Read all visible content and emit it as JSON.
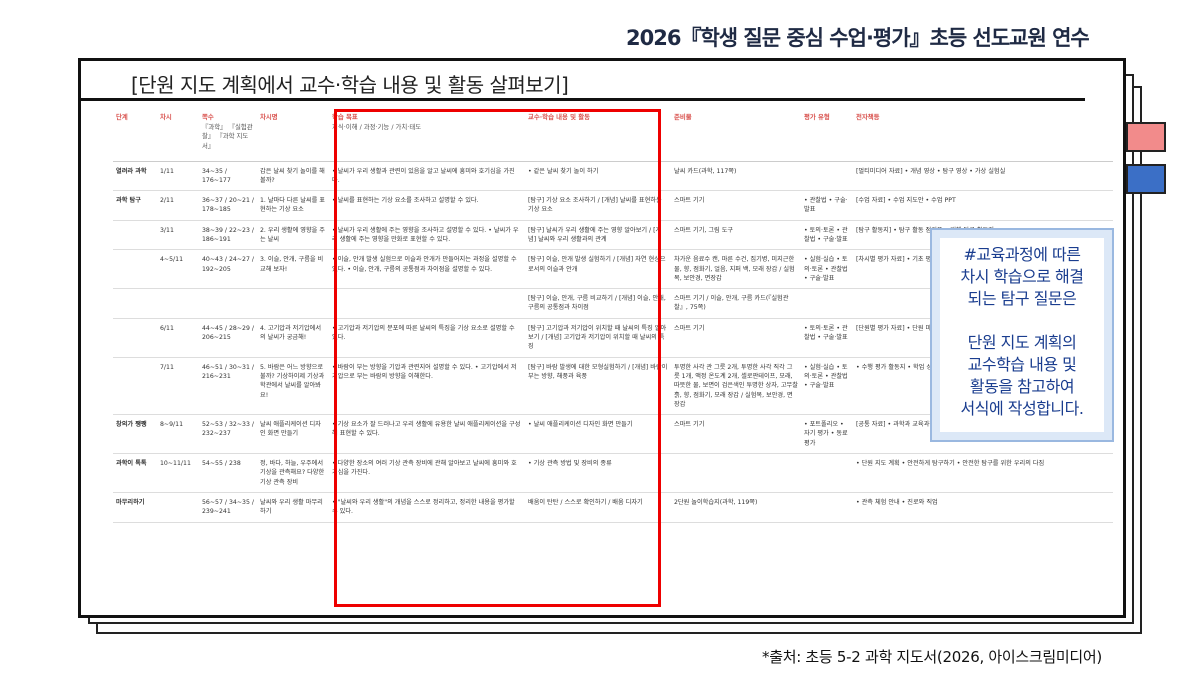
{
  "header": {
    "title": "2026『학생 질문 중심 수업·평가』초등 선도교원 연수"
  },
  "section": {
    "title": "[단원 지도 계획에서 교수·학습 내용 및 활동 살펴보기]"
  },
  "table": {
    "headers": [
      "단계",
      "차시",
      "쪽수",
      "차시명",
      "학습 목표",
      "교수·학습 내용 및 활동",
      "준비물",
      "평가 유형",
      "전자책등"
    ],
    "header_notes": {
      "pages": "『과학』 『실험관찰』 『과학 지도서』",
      "goal": "지식·이해 / 과정·기능 / 가치·태도"
    },
    "rows": [
      {
        "stage": "열려라 과학",
        "period": "1/11",
        "pages": "34~35 / 176~177",
        "name": "갑은 날씨 찾기 놀이를 해 볼까?",
        "goal": "• 날씨가 우리 생활과 관련이 있음을 알고 날씨에 흥미와 호기심을 가진다.",
        "activity": "• 같은 날씨 찾기 놀이 하기",
        "materials": "날씨 카드(과학, 117쪽)",
        "eval": "",
        "ebook": "[멀티미디어 자료] • 개념 영상 • 탐구 영상 • 가상 실험실"
      },
      {
        "stage": "과학 탐구",
        "period": "2/11",
        "pages": "36~37 / 20~21 / 178~185",
        "name": "1. 날마다 다른 날씨를 표현하는 기상 요소",
        "goal": "• 날씨를 표현하는 기상 요소를 조사하고 설명할 수 있다.",
        "activity": "[탐구] 기상 요소 조사하기 / [개념] 날씨를 표현하는 기상 요소",
        "materials": "스마트 기기",
        "eval": "• 관찰법 • 구술·발표",
        "ebook": "[수업 자료] • 수업 지도안 • 수업 PPT"
      },
      {
        "stage": "",
        "period": "3/11",
        "pages": "38~39 / 22~23 / 186~191",
        "name": "2. 우리 생활에 영향을 주는 날씨",
        "goal": "• 날씨가 우리 생활에 주는 영향을 조사하고 설명할 수 있다. • 날씨가 우리 생활에 주는 영향을 만화로 표현할 수 있다.",
        "activity": "[탐구] 날씨가 우리 생활에 주는 영향 알아보기 / [개념] 날씨와 우리 생활과의 관계",
        "materials": "스마트 기기, 그림 도구",
        "eval": "• 토의·토론 • 관찰법 • 구술·발표",
        "ebook": "[탐구 활동지] • 탐구 활동 점검표 • 대체 탐구 활동지"
      },
      {
        "stage": "",
        "period": "4~5/11",
        "pages": "40~43 / 24~27 / 192~205",
        "name": "3. 이슬, 안개, 구름을 비교해 보자!",
        "goal": "• 이슬, 안개 발생 실험으로 이슬과 안개가 만들어지는 과정을 설명할 수 있다. • 이슬, 안개, 구름의 공통점과 차이점을 설명할 수 있다.",
        "activity": "[탐구] 이슬, 안개 발생 실험하기 / [개념] 자연 현상으로서의 이슬과 안개",
        "materials": "차가운 음료수 캔, 마른 수건, 집기병, 미지근한 물, 향, 점화기, 얼음, 지퍼 백, 모래 장갑 / 실험복, 보안경, 면장갑",
        "eval": "• 실험·실습 • 토의·토론 • 관찰법 • 구술·발표",
        "ebook": "[차시별 평가 자료] • 기초 평가 • 실력 평가 • 심화 학습 평가 • 차시 평가 방법 및 채점 기준"
      },
      {
        "stage": "",
        "period": "",
        "pages": "",
        "name": "",
        "goal": "",
        "activity": "[탐구] 이슬, 안개, 구름 비교하기 / [개념] 이슬, 안개, 구름의 공통점과 차이점",
        "materials": "스마트 기기 / 이슬, 안개, 구름 카드(『실험관찰』, 75쪽)",
        "eval": "",
        "ebook": ""
      },
      {
        "stage": "",
        "period": "6/11",
        "pages": "44~45 / 28~29 / 206~215",
        "name": "4. 고기압과 저기압에서의 날씨가 궁금해!",
        "goal": "• 고기압과 저기압의 분포에 따른 날씨의 특징을 기상 요소로 설명할 수 있다.",
        "activity": "[탐구] 고기압과 저기압이 위치할 때 날씨의 특징 알아보기 / [개념] 고기압과 저기압이 위치할 때 날씨의 특징",
        "materials": "스마트 기기",
        "eval": "• 토의·토론 • 관찰법 • 구술·발표",
        "ebook": "[단원별 평가 자료] • 단원 마무리 활동지 • 놀이로 마무리 활동지"
      },
      {
        "stage": "",
        "period": "7/11",
        "pages": "46~51 / 30~31 / 216~231",
        "name": "5. 바람은 어느 방향으로 불까? 기상하이제 기상과학관에서 날씨를 알아봐요!",
        "goal": "• 바람이 부는 방향을 기압과 관련지어 설명할 수 있다. • 고기압에서 저기압으로 부는 바람의 방향을 이해한다.",
        "activity": "[탐구] 바람 발생에 대한 모형실험하기 / [개념] 바람이 부는 방향, 해풍과 육풍",
        "materials": "투명한 사각 관 그릇 2개, 투명한 사각 직각 그릇 1개, 액정 온도계 2개, 셀로판테이프, 모래, 따뜻한 물, 보면이 검은색인 투명한 상자, 고무찰흙, 향, 점화기, 모래 장갑 / 실험복, 보안경, 면장갑",
        "eval": "• 실험·실습 • 토의·토론 • 관찰법 • 구술·발표",
        "ebook": "• 수행 평가 활동지 • 학업 성취도 평가 • 심화 평가 • 서술형 평가 • 단원 평가"
      },
      {
        "stage": "창의가 쨍쨍",
        "period": "8~9/11",
        "pages": "52~53 / 32~33 / 232~237",
        "name": "날씨 애플리케이션 디자인 화면 만들기",
        "goal": "• 기상 요소가 잘 드러나고 우리 생활에 유용한 날씨 애플리케이션을 구성해 표현할 수 있다.",
        "activity": "• 날씨 애플리케이션 디자인 화면 만들기",
        "materials": "스마트 기기",
        "eval": "• 포트폴리오 • 자기 평가 • 동료 평가",
        "ebook": "[공통 자료] • 과학과 교육과정 • 연수자료 • 학기 지도 계획"
      },
      {
        "stage": "과학이 톡톡",
        "period": "10~11/11",
        "pages": "54~55 / 238",
        "name": "정, 바다, 하늘, 우주에서 기상을 관측해요? 다양한 기상 관측 장비",
        "goal": "• 다양한 장소의 여러 기상 관측 장비에 관해 알아보고 날씨에 흥미와 호기심을 가진다.",
        "activity": "• 기상 관측 방법 및 장비의 종류",
        "materials": "",
        "eval": "",
        "ebook": "• 단원 지도 계획 • 안전하게 탐구하기 • 안전한 탐구를 위한 우리의 다짐"
      },
      {
        "stage": "마무리하기",
        "period": "",
        "pages": "56~57 / 34~35 / 239~241",
        "name": "날씨와 우리 생활 마무리하기",
        "goal": "• \"날씨와 우리 생활\"의 개념을 스스로 정리하고, 정리한 내용을 평가할 수 있다.",
        "activity": "배움이 탄탄 / 스스로 확인하기 / 배움 디자기",
        "materials": "2단원 놀이학습지(과학, 119쪽)",
        "eval": "",
        "ebook": "• 관측 체험 안내 • 진로와 직업"
      }
    ]
  },
  "callout": {
    "text": "#교육과정에 따른\n차시 학습으로 해결\n되는 탐구 질문은\n\n단원 지도 계획의\n교수학습 내용 및\n활동을 참고하여\n서식에 작성합니다."
  },
  "source": {
    "text": "*출처: 초등 5-2 과학 지도서(2026, 아이스크림미디어)"
  },
  "colors": {
    "highlight_box": "#e00000",
    "header_text": "#d9534f",
    "callout_text": "#1a3d8f",
    "callout_bg": "#dce8f7",
    "tab_pink": "#f28b8b",
    "tab_blue": "#3b6fc6"
  }
}
